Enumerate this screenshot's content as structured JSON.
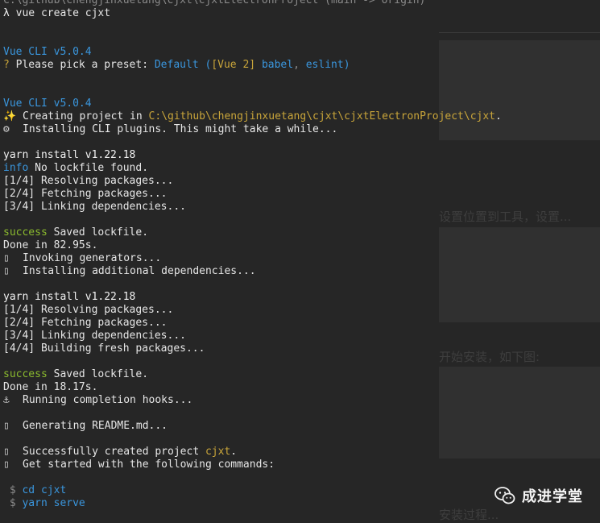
{
  "terminal": {
    "header": "C:\\github\\chengjinxuetang\\cjxt\\cjxtElectronProject (main -> origin)",
    "command_prompt": "λ",
    "command": "vue create cjxt",
    "cli_version_1": "Vue CLI v5.0.4",
    "preset_prefix": "?",
    "preset_question": "Please pick a preset:",
    "preset_name": "Default",
    "preset_open": "(",
    "preset_vue": "[Vue 2]",
    "preset_babel": "babel",
    "preset_comma": ",",
    "preset_eslint": "eslint",
    "preset_close": ")",
    "cli_version_2": "Vue CLI v5.0.4",
    "creating_text": "Creating project in",
    "creating_path": "C:\\github\\chengjinxuetang\\cjxt\\cjxtElectronProject\\cjxt",
    "creating_end": ".",
    "installing_plugins": "Installing CLI plugins. This might take a while...",
    "yarn_install_1": "yarn install v1.22.18",
    "info_label": "info",
    "no_lockfile": "No lockfile found.",
    "steps_1": [
      "[1/4] Resolving packages...",
      "[2/4] Fetching packages...",
      "[3/4] Linking dependencies..."
    ],
    "success_label_1": "success",
    "saved_lockfile_1": "Saved lockfile.",
    "done_1": "Done in 82.95s.",
    "invoking_generators": "Invoking generators...",
    "installing_additional": "Installing additional dependencies...",
    "yarn_install_2": "yarn install v1.22.18",
    "steps_2": [
      "[1/4] Resolving packages...",
      "[2/4] Fetching packages...",
      "[3/4] Linking dependencies...",
      "[4/4] Building fresh packages..."
    ],
    "success_label_2": "success",
    "saved_lockfile_2": "Saved lockfile.",
    "done_2": "Done in 18.17s.",
    "running_hooks": "Running completion hooks...",
    "generating_readme": "Generating README.md...",
    "success_created": "Successfully created project",
    "project_name": "cjxt",
    "success_created_end": ".",
    "get_started": "Get started with the following commands:",
    "cmd_prompt": "$",
    "cmd_1": "cd cjxt",
    "cmd_2": "yarn serve",
    "placeholder_glyph": "▯"
  },
  "ghost": {
    "label_1": "设置位置到工具，设置...",
    "label_2": "开始安装，如下图:",
    "label_3": "安装过程..."
  },
  "watermark": {
    "text": "成进学堂"
  },
  "colors": {
    "background": "#262626",
    "blue": "#3a96dd",
    "green": "#8ab92e",
    "yellow": "#c9a53a"
  }
}
